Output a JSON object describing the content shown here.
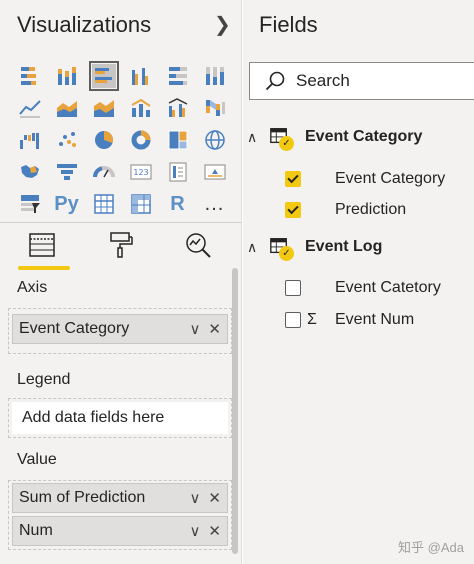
{
  "visualizations": {
    "title": "Visualizations",
    "expand_icon": "chevron-right-icon",
    "gallery": [
      "stacked-bar-icon",
      "stacked-column-icon",
      "clustered-bar-icon",
      "clustered-column-icon",
      "100-bar-icon",
      "100-column-icon",
      "line-icon",
      "area-icon",
      "stacked-area-icon",
      "line-column-icon",
      "line-clustered-column-icon",
      "ribbon-icon",
      "waterfall-icon",
      "scatter-icon",
      "pie-icon",
      "donut-icon",
      "treemap-icon",
      "map-icon",
      "filled-map-icon",
      "funnel-icon",
      "gauge-icon",
      "card-icon",
      "multirow-card-icon",
      "kpi-icon",
      "slicer-icon",
      "Py",
      "table-icon",
      "matrix-icon",
      "R",
      "..."
    ],
    "tabs": [
      "fields-tab-icon",
      "format-tab-icon",
      "analytics-tab-icon"
    ],
    "wells": {
      "axis": {
        "label": "Axis",
        "chip": "Event Category"
      },
      "legend": {
        "label": "Legend",
        "placeholder": "Add data fields here"
      },
      "value": {
        "label": "Value",
        "chips": [
          "Sum of Prediction",
          "Num"
        ]
      }
    }
  },
  "fields": {
    "title": "Fields",
    "search_placeholder": "Search",
    "tables": [
      {
        "name": "Event Category",
        "fields": [
          {
            "label": "Event Category",
            "checked": true,
            "type": ""
          },
          {
            "label": "Prediction",
            "checked": true,
            "type": ""
          }
        ]
      },
      {
        "name": "Event Log",
        "fields": [
          {
            "label": "Event Catetory",
            "checked": false,
            "type": ""
          },
          {
            "label": "Event Num",
            "checked": false,
            "type": "Σ"
          }
        ]
      }
    ]
  },
  "watermark": "知乎 @Ada",
  "colors": {
    "accent": "#f2c811",
    "pane": "#f3f2f1"
  }
}
